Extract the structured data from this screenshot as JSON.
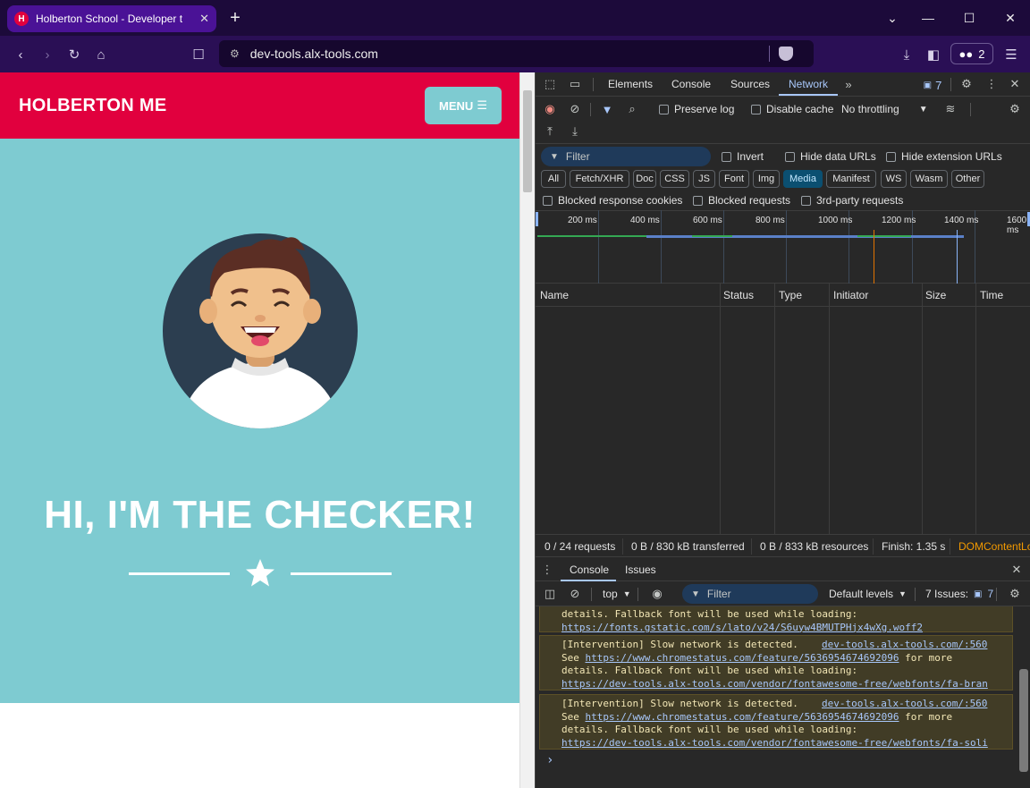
{
  "browser": {
    "tab_title": "Holberton School - Developer t",
    "tab_favicon": "H",
    "url": "dev-tools.alx-tools.com",
    "rewards_count": "2"
  },
  "page": {
    "brand": "HOLBERTON ME",
    "menu_label": "MENU",
    "hero_title": "HI, I'M THE CHECKER!",
    "colors": {
      "header": "#e1003e",
      "hero": "#7ecbd1"
    }
  },
  "devtools": {
    "tabs": [
      "Elements",
      "Console",
      "Sources",
      "Network"
    ],
    "active_tab": "Network",
    "issues_badge": "7",
    "network_toolbar": {
      "preserve_log": "Preserve log",
      "disable_cache": "Disable cache",
      "throttling": "No throttling"
    },
    "filter": {
      "placeholder": "Filter",
      "invert": "Invert",
      "hide_data_urls": "Hide data URLs",
      "hide_extension_urls": "Hide extension URLs"
    },
    "type_chips": [
      "All",
      "Fetch/XHR",
      "Doc",
      "CSS",
      "JS",
      "Font",
      "Img",
      "Media",
      "Manifest",
      "WS",
      "Wasm",
      "Other"
    ],
    "active_chip": "Media",
    "extra_filters": {
      "blocked_cookies": "Blocked response cookies",
      "blocked_requests": "Blocked requests",
      "third_party": "3rd-party requests"
    },
    "timeline_ticks": [
      "200 ms",
      "400 ms",
      "600 ms",
      "800 ms",
      "1000 ms",
      "1200 ms",
      "1400 ms",
      "1600 ms"
    ],
    "columns": [
      "Name",
      "Status",
      "Type",
      "Initiator",
      "Size",
      "Time"
    ],
    "status_bar": {
      "requests": "0 / 24 requests",
      "transferred": "0 B / 830 kB transferred",
      "resources": "0 B / 833 kB resources",
      "finish": "Finish: 1.35 s",
      "dom": "DOMContentLo"
    },
    "drawer": {
      "tabs": [
        "Console",
        "Issues"
      ],
      "context": "top",
      "filter_placeholder": "Filter",
      "levels": "Default levels",
      "issues": "7 Issues:",
      "issues_count": "7"
    },
    "console_messages": [
      {
        "lines": [
          "details. Fallback font will be used while loading:"
        ],
        "link": "https://fonts.gstatic.com/s/lato/v24/S6uyw4BMUTPHjx4wXg.woff2"
      },
      {
        "head": "[Intervention] Slow network is detected.",
        "source": "dev-tools.alx-tools.com/:560",
        "see": "See ",
        "see_link": "https://www.chromestatus.com/feature/5636954674692096",
        "see_tail": " for more",
        "line3": "details. Fallback font will be used while loading:",
        "link": "https://dev-tools.alx-tools.com/vendor/fontawesome-free/webfonts/fa-bran"
      },
      {
        "head": "[Intervention] Slow network is detected.",
        "source": "dev-tools.alx-tools.com/:560",
        "see": "See ",
        "see_link": "https://www.chromestatus.com/feature/5636954674692096",
        "see_tail": " for more",
        "line3": "details. Fallback font will be used while loading:",
        "link": "https://dev-tools.alx-tools.com/vendor/fontawesome-free/webfonts/fa-soli"
      }
    ],
    "prompt": "›"
  }
}
